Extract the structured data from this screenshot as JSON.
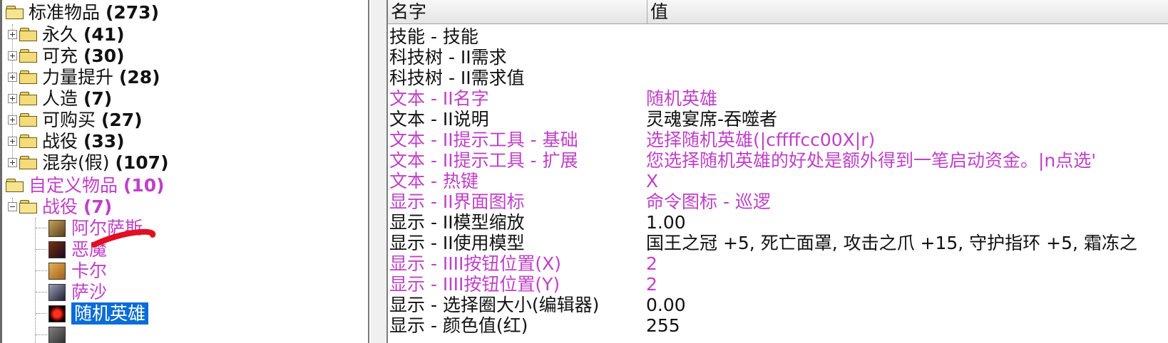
{
  "tree": {
    "root_standard": {
      "label": "标准物品",
      "count": "(273)"
    },
    "standard_children": [
      {
        "label": "永久",
        "count": "(41)"
      },
      {
        "label": "可充",
        "count": "(30)"
      },
      {
        "label": "力量提升",
        "count": "(28)"
      },
      {
        "label": "人造",
        "count": "(7)"
      },
      {
        "label": "可购买",
        "count": "(27)"
      },
      {
        "label": "战役",
        "count": "(33)"
      },
      {
        "label": "混杂(假)",
        "count": "(107)"
      }
    ],
    "root_custom": {
      "label": "自定义物品",
      "count": "(10)"
    },
    "custom_campaign": {
      "label": "战役",
      "count": "(7)"
    },
    "heroes": [
      {
        "label": "阿尔萨斯",
        "icon": "hero-portrait-icon"
      },
      {
        "label": "恶魔",
        "icon": "hero-portrait-icon"
      },
      {
        "label": "卡尔",
        "icon": "hero-portrait-icon"
      },
      {
        "label": "萨沙",
        "icon": "hero-portrait-icon"
      },
      {
        "label": "随机英雄",
        "icon": "random-hero-icon"
      }
    ],
    "colors": {
      "modified": "#c040c8",
      "selection": "#0a6cd6"
    }
  },
  "list": {
    "columns": {
      "name": "名字",
      "value": "值"
    },
    "rows": [
      {
        "name": "技能 - 技能",
        "value": "",
        "modified": false
      },
      {
        "name": "科技树 - II需求",
        "value": "",
        "modified": false
      },
      {
        "name": "科技树 - II需求值",
        "value": "",
        "modified": false
      },
      {
        "name": "文本 - II名字",
        "value": "随机英雄",
        "modified": true
      },
      {
        "name": "文本 - II说明",
        "value": "灵魂宴席-吞噬者",
        "modified": false
      },
      {
        "name": "文本 - II提示工具 - 基础",
        "value": "选择随机英雄(|cffffcc00X|r)",
        "modified": true
      },
      {
        "name": "文本 - II提示工具 - 扩展",
        "value": "您选择随机英雄的好处是额外得到一笔启动资金。|n点选'",
        "modified": true
      },
      {
        "name": "文本 - 热键",
        "value": "X",
        "modified": true
      },
      {
        "name": "显示 - II界面图标",
        "value": "命令图标 - 巡逻",
        "modified": true
      },
      {
        "name": "显示 - II模型缩放",
        "value": "1.00",
        "modified": false
      },
      {
        "name": "显示 - II使用模型",
        "value": "国王之冠 +5, 死亡面罩, 攻击之爪 +15, 守护指环 +5, 霜冻之",
        "modified": false
      },
      {
        "name": "显示 - IIII按钮位置(X)",
        "value": "2",
        "modified": true
      },
      {
        "name": "显示 - IIII按钮位置(Y)",
        "value": "2",
        "modified": true
      },
      {
        "name": "显示 - 选择圈大小(编辑器)",
        "value": "0.00",
        "modified": false
      },
      {
        "name": "显示 - 颜色值(红)",
        "value": "255",
        "modified": false
      }
    ]
  }
}
